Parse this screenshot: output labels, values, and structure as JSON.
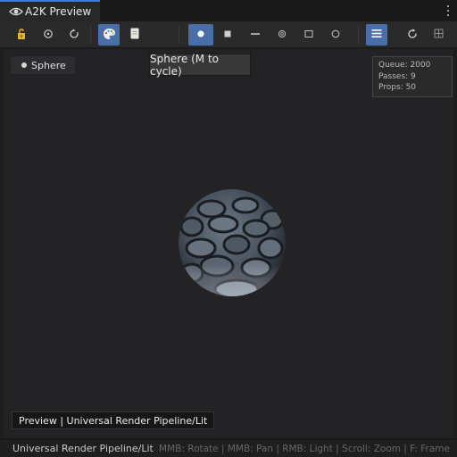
{
  "window": {
    "title": "A2K Preview"
  },
  "toolbar": {
    "buttons": [
      {
        "icon": "lock-icon",
        "active": false
      },
      {
        "icon": "target-icon",
        "active": false
      },
      {
        "icon": "reset-rotation-icon",
        "active": false
      },
      {
        "icon": "palette-icon",
        "active": true
      },
      {
        "icon": "page-icon",
        "active": false
      },
      {
        "icon": "sphere-mesh-icon",
        "active": true
      },
      {
        "icon": "cube-mesh-icon",
        "active": false
      },
      {
        "icon": "plane-mesh-icon",
        "active": false
      },
      {
        "icon": "cylinder-mesh-icon",
        "active": false
      },
      {
        "icon": "quad-mesh-icon",
        "active": false
      },
      {
        "icon": "capsule-mesh-icon",
        "active": false
      },
      {
        "icon": "menu-icon",
        "active": true
      },
      {
        "icon": "refresh-icon",
        "active": false
      },
      {
        "icon": "grid-icon",
        "active": false
      }
    ]
  },
  "viewport": {
    "mesh_label": "Sphere",
    "tooltip": "Sphere (M to cycle)",
    "stats": {
      "queue": "Queue: 2000",
      "passes": "Passes: 9",
      "props": "Props: 50"
    },
    "footer_label": "Preview | Universal Render Pipeline/Lit"
  },
  "status": {
    "shader": "Universal Render Pipeline/Lit",
    "hints": "MMB: Rotate | MMB: Pan | RMB: Light | Scroll: Zoom | F: Frame"
  },
  "colors": {
    "accent": "#4a6ea8",
    "tab_highlight": "#3d7bd6",
    "background": "#1e1e1e",
    "viewport": "#232325"
  }
}
